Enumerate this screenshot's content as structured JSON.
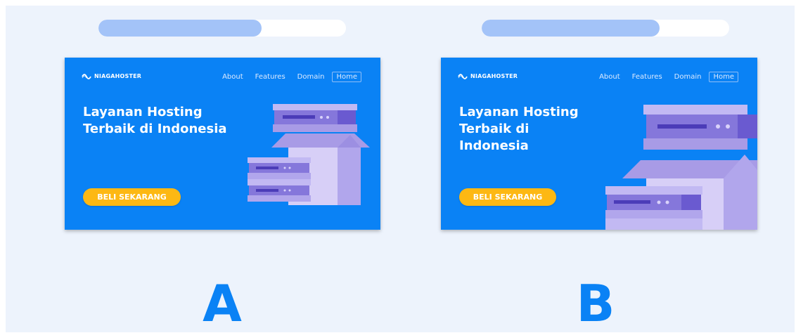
{
  "variants": [
    {
      "id": "A",
      "label": "A",
      "progress": 0.66,
      "site": {
        "logo": "NIAGAHOSTER",
        "nav": [
          "About",
          "Features",
          "Domain"
        ],
        "nav_active": "Home",
        "headline_lines": [
          "Layanan Hosting",
          "Terbaik di Indonesia"
        ],
        "cta": "BELI SEKARANG"
      }
    },
    {
      "id": "B",
      "label": "B",
      "progress": 0.72,
      "site": {
        "logo": "NIAGAHOSTER",
        "nav": [
          "About",
          "Features",
          "Domain"
        ],
        "nav_active": "Home",
        "headline_lines": [
          "Layanan Hosting",
          "Terbaik di",
          "Indonesia"
        ],
        "cta": "BELI SEKARANG"
      }
    }
  ],
  "colors": {
    "page_bg": "#edf3fc",
    "card_bg": "#0a82f5",
    "progress_fill": "#a3c3f8",
    "cta_bg": "#fdb813",
    "label": "#0a82f5"
  }
}
